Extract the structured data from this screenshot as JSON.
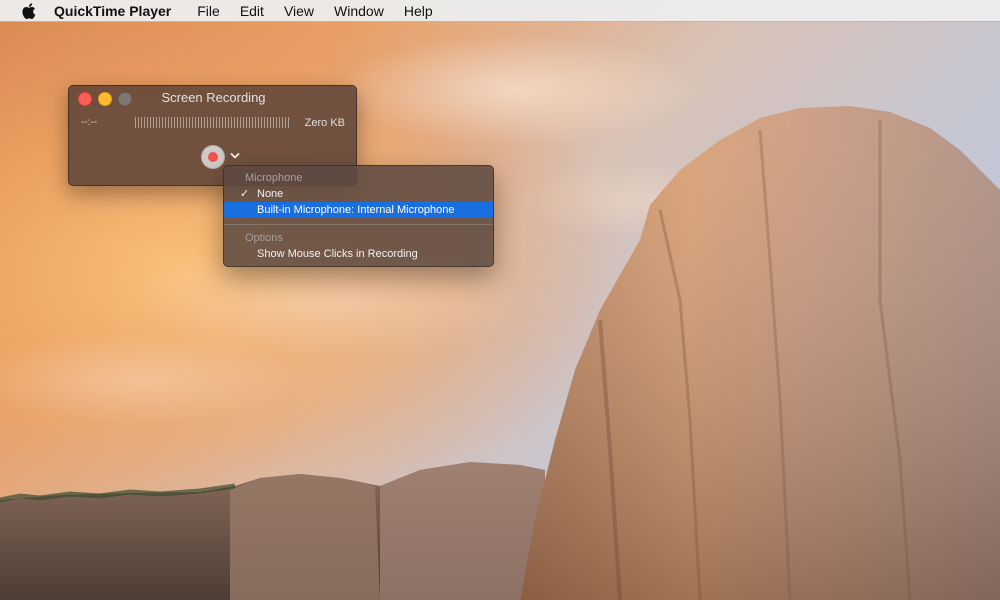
{
  "menubar": {
    "apple_icon": "apple-logo-icon",
    "app_name": "QuickTime Player",
    "items": [
      "File",
      "Edit",
      "View",
      "Window",
      "Help"
    ]
  },
  "recording_window": {
    "title": "Screen Recording",
    "elapsed_time": "--:--",
    "file_size": "Zero KB",
    "record_button_icon": "record-icon",
    "options_icon": "chevron-down-icon"
  },
  "options_menu": {
    "microphone_header": "Microphone",
    "microphone_items": [
      {
        "label": "None",
        "checked": true,
        "highlighted": false
      },
      {
        "label": "Built-in Microphone: Internal Microphone",
        "checked": false,
        "highlighted": true
      }
    ],
    "options_header": "Options",
    "options_items": [
      {
        "label": "Show Mouse Clicks in Recording",
        "checked": false,
        "highlighted": false
      }
    ]
  },
  "colors": {
    "highlight": "#1a6fe0",
    "record_red": "#f2524c",
    "close_button": "#fd5f57",
    "minimize_button": "#febc2e"
  }
}
